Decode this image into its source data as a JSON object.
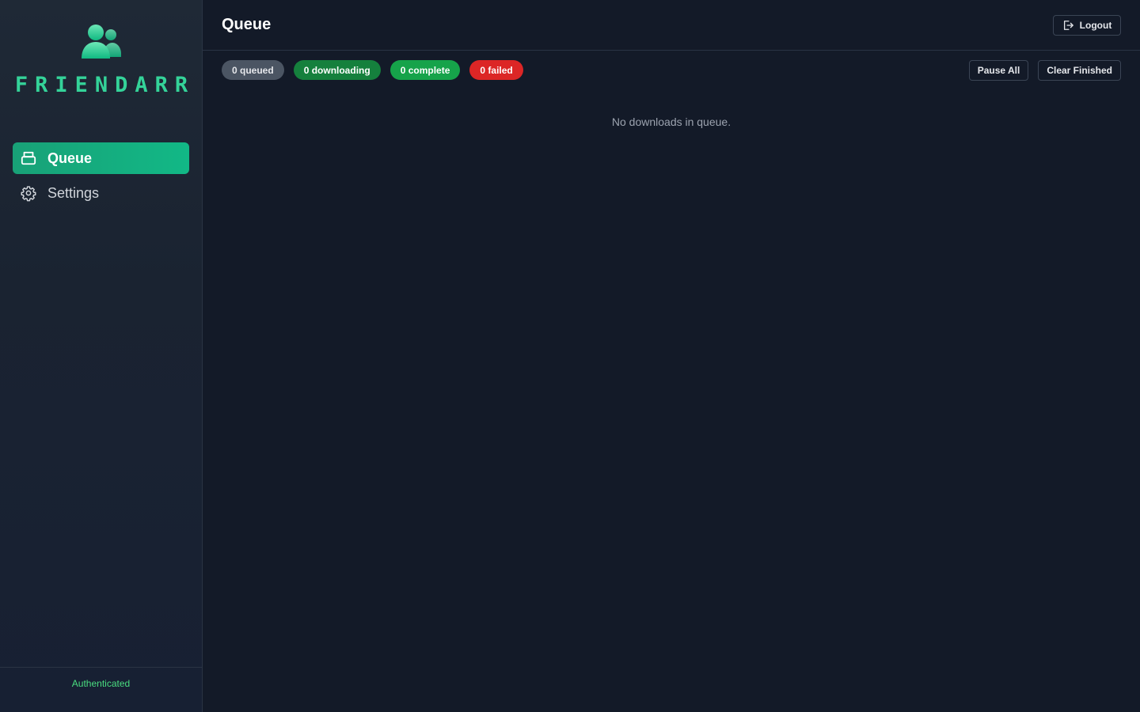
{
  "app": {
    "name": "FRIENDARR",
    "logo_icon": "users-icon",
    "accent_color": "#34d399"
  },
  "sidebar": {
    "items": [
      {
        "label": "Queue",
        "icon": "inbox-icon",
        "active": true
      },
      {
        "label": "Settings",
        "icon": "gear-icon",
        "active": false
      }
    ],
    "footer_status": "Authenticated"
  },
  "header": {
    "title": "Queue",
    "logout_label": "Logout",
    "logout_icon": "logout-icon"
  },
  "status_badges": {
    "queued": "0 queued",
    "downloading": "0 downloading",
    "complete": "0 complete",
    "failed": "0 failed"
  },
  "actions": {
    "pause_all": "Pause All",
    "clear_finished": "Clear Finished"
  },
  "main": {
    "empty_message": "No downloads in queue."
  }
}
